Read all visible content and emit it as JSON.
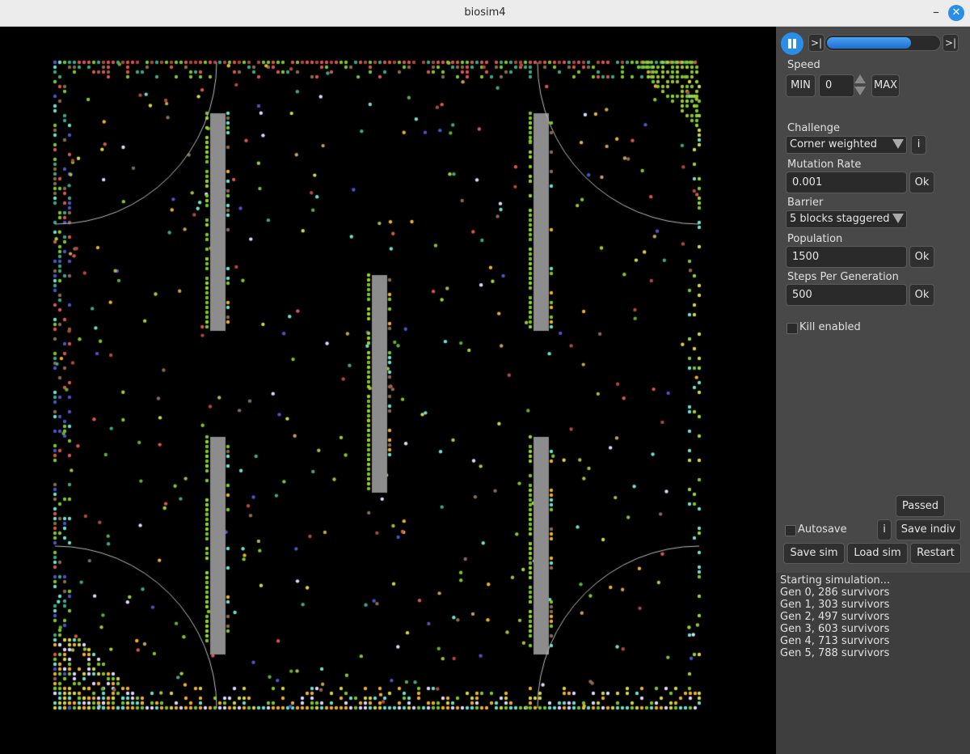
{
  "window": {
    "title": "biosim4"
  },
  "controls": {
    "step_button": ">|",
    "end_button": ">|",
    "progress_fraction": 0.74,
    "speed_label": "Speed",
    "min_button": "MIN",
    "speed_value": "0",
    "max_button": "MAX",
    "challenge_label": "Challenge",
    "challenge_value": "Corner weighted",
    "info_button": "i",
    "mutation_label": "Mutation Rate",
    "mutation_value": "0.001",
    "ok_button": "Ok",
    "barrier_label": "Barrier",
    "barrier_value": "5 blocks staggered",
    "population_label": "Population",
    "population_value": "1500",
    "steps_label": "Steps Per Generation",
    "steps_value": "500",
    "kill_label": "Kill enabled",
    "passed_button": "Passed",
    "autosave_label": "Autosave",
    "save_indiv_button": "Save indiv",
    "save_sim_button": "Save sim",
    "load_sim_button": "Load sim",
    "restart_button": "Restart"
  },
  "log": [
    "Starting simulation...",
    "Gen 0, 286 survivors",
    "Gen 1, 303 survivors",
    "Gen 2, 497 survivors",
    "Gen 3, 603 survivors",
    "Gen 4, 713 survivors",
    "Gen 5, 788 survivors"
  ],
  "colors": {
    "accent": "#2a8ee8",
    "barrier": "#8c8c8c",
    "panel": "#484848",
    "creature_palette": [
      "#7ec828",
      "#9ad62e",
      "#5fb030",
      "#d9574a",
      "#8a6a52",
      "#3ca88a",
      "#6fe0d0",
      "#f0b030",
      "#d6d648",
      "#b04a3a",
      "#e0d8ff",
      "#4a56c8",
      "#c8a050",
      "#a0c040"
    ]
  }
}
